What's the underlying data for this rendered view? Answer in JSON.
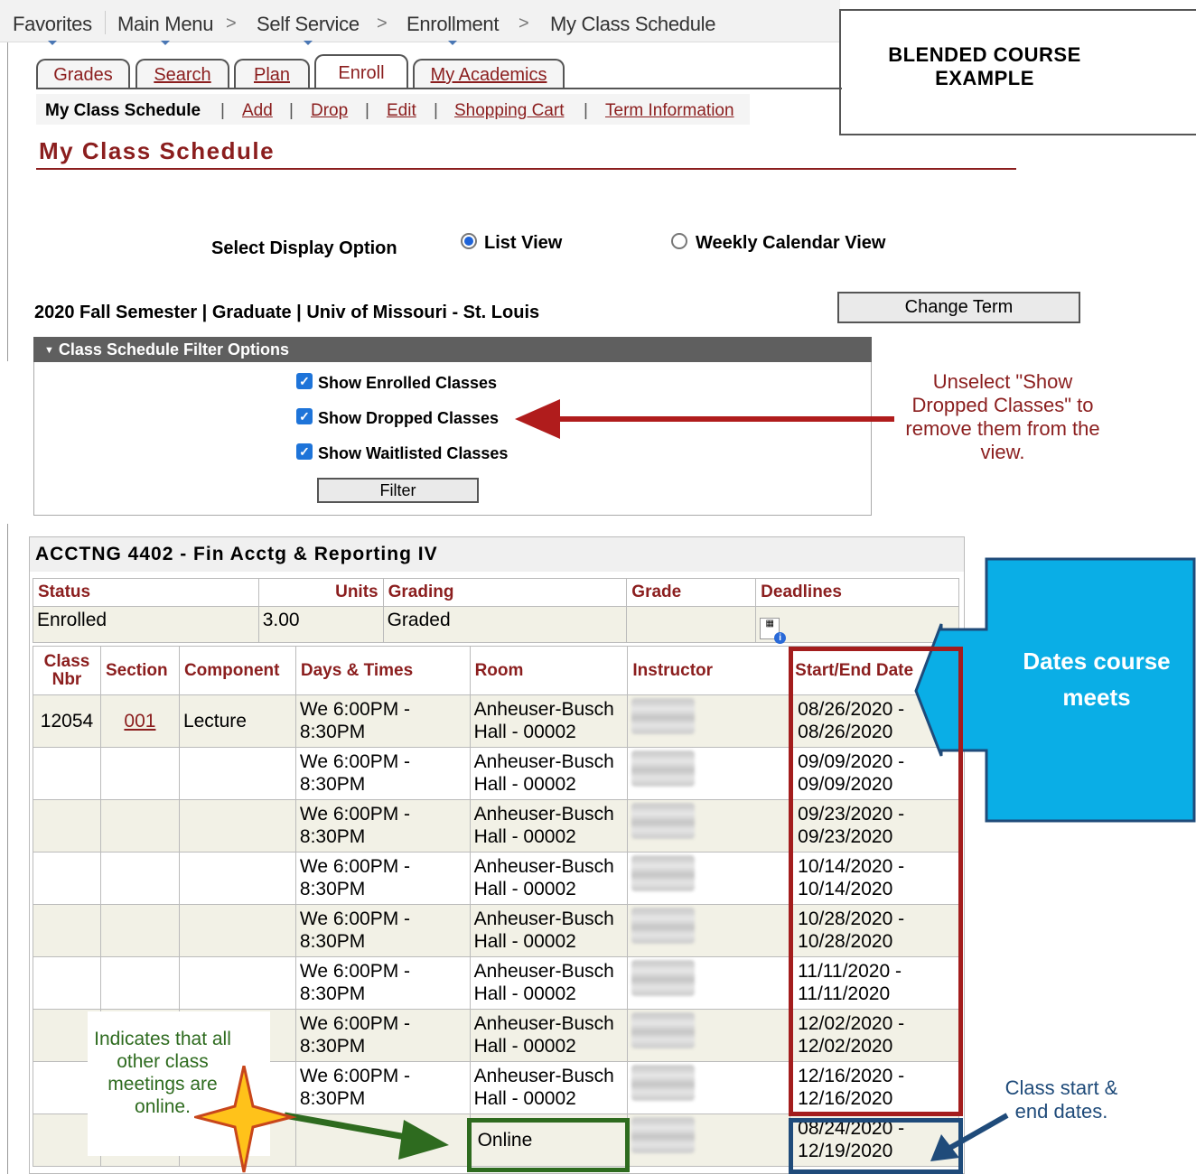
{
  "nav": {
    "favorites": "Favorites",
    "main_menu": "Main Menu",
    "self_service": "Self Service",
    "enrollment": "Enrollment",
    "current": "My Class Schedule",
    "sep": ">"
  },
  "tabs": [
    "Grades",
    "Search",
    "Plan",
    "Enroll",
    "My Academics"
  ],
  "subnav": {
    "current": "My Class Schedule",
    "links": [
      "Add",
      "Drop",
      "Edit",
      "Shopping Cart",
      "Term Information"
    ],
    "sep": "|"
  },
  "callout_title": "BLENDED COURSE EXAMPLE",
  "page_title": "My Class Schedule",
  "display": {
    "label": "Select Display Option",
    "option1": "List View",
    "option2": "Weekly Calendar View"
  },
  "term": "2020 Fall Semester | Graduate | Univ of Missouri - St. Louis",
  "change_term": "Change Term",
  "filter": {
    "header": "Class Schedule Filter Options",
    "opt1": "Show Enrolled Classes",
    "opt2": "Show Dropped Classes",
    "opt3": "Show Waitlisted Classes",
    "button": "Filter"
  },
  "annotations": {
    "dropped": "Unselect \"Show Dropped Classes\" to remove them from the view.",
    "dates": "Dates course meets",
    "online": "Indicates that all other class meetings are online.",
    "startend": "Class start & end dates."
  },
  "course": {
    "title": "ACCTNG 4402 - Fin Acctg & Reporting IV",
    "status_headers": [
      "Status",
      "Units",
      "Grading",
      "Grade",
      "Deadlines"
    ],
    "status": "Enrolled",
    "units": "3.00",
    "grading": "Graded",
    "headers": [
      "Class Nbr",
      "Section",
      "Component",
      "Days & Times",
      "Room",
      "Instructor",
      "Start/End Date"
    ],
    "class_nbr": "12054",
    "section": "001",
    "component": "Lecture",
    "meetings": [
      {
        "days": "We 6:00PM - 8:30PM",
        "room": "Anheuser-Busch Hall - 00002",
        "dates": "08/26/2020 - 08/26/2020"
      },
      {
        "days": "We 6:00PM - 8:30PM",
        "room": "Anheuser-Busch Hall - 00002",
        "dates": "09/09/2020 - 09/09/2020"
      },
      {
        "days": "We 6:00PM - 8:30PM",
        "room": "Anheuser-Busch Hall - 00002",
        "dates": "09/23/2020 - 09/23/2020"
      },
      {
        "days": "We 6:00PM - 8:30PM",
        "room": "Anheuser-Busch Hall - 00002",
        "dates": "10/14/2020 - 10/14/2020"
      },
      {
        "days": "We 6:00PM - 8:30PM",
        "room": "Anheuser-Busch Hall - 00002",
        "dates": "10/28/2020 - 10/28/2020"
      },
      {
        "days": "We 6:00PM - 8:30PM",
        "room": "Anheuser-Busch Hall - 00002",
        "dates": "11/11/2020 - 11/11/2020"
      },
      {
        "days": "We 6:00PM - 8:30PM",
        "room": "Anheuser-Busch Hall - 00002",
        "dates": "12/02/2020 - 12/02/2020"
      },
      {
        "days": "We 6:00PM - 8:30PM",
        "room": "Anheuser-Busch Hall - 00002",
        "dates": "12/16/2020 - 12/16/2020"
      },
      {
        "days": "",
        "room": "Online",
        "dates": "08/24/2020 - 12/19/2020"
      }
    ]
  },
  "colors": {
    "brand": "#8b1e1e",
    "callout_blue": "#0aaee6",
    "accent_green": "#2e6b1f",
    "accent_navy": "#1f4b7a"
  }
}
